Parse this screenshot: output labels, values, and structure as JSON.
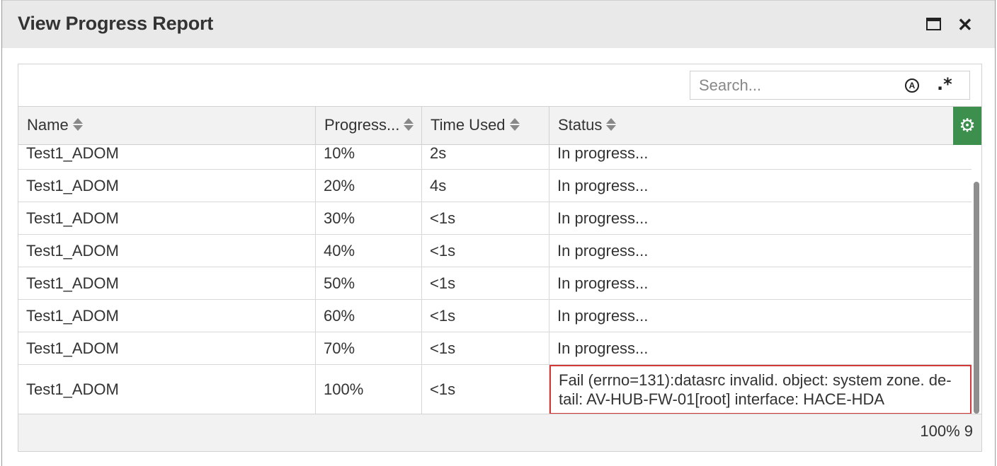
{
  "dialog": {
    "title": "View Progress Report",
    "maximize_icon": "window-maximize-icon",
    "close_icon": "close-icon",
    "close_glyph": "✕"
  },
  "toolbar": {
    "search_placeholder": "Search...",
    "search_mode_icon": "a-circle-icon",
    "search_mode_glyph": "A",
    "regex_icon": "regex-icon",
    "regex_glyph": ".*"
  },
  "table": {
    "columns": [
      "Name",
      "Progress...",
      "Time Used",
      "Status"
    ],
    "settings_icon": "gear-icon",
    "settings_glyph": "⚙",
    "settings_color": "#3c8f4d",
    "rows": [
      {
        "name": "Test1_ADOM",
        "progress": "10%",
        "time": "2s",
        "status": "In progress..."
      },
      {
        "name": "Test1_ADOM",
        "progress": "20%",
        "time": "4s",
        "status": "In progress..."
      },
      {
        "name": "Test1_ADOM",
        "progress": "30%",
        "time": "<1s",
        "status": "In progress..."
      },
      {
        "name": "Test1_ADOM",
        "progress": "40%",
        "time": "<1s",
        "status": "In progress..."
      },
      {
        "name": "Test1_ADOM",
        "progress": "50%",
        "time": "<1s",
        "status": "In progress..."
      },
      {
        "name": "Test1_ADOM",
        "progress": "60%",
        "time": "<1s",
        "status": "In progress..."
      },
      {
        "name": "Test1_ADOM",
        "progress": "70%",
        "time": "<1s",
        "status": "In progress..."
      },
      {
        "name": "Test1_ADOM",
        "progress": "100%",
        "time": "<1s",
        "status": "Fail (errno=131):datasrc invalid. object: system zone. de-tail: AV-HUB-FW-01[root] interface: HACE-HDA"
      }
    ],
    "error_border_color": "#d23a3a"
  },
  "footer": {
    "summary": "100% 9"
  }
}
